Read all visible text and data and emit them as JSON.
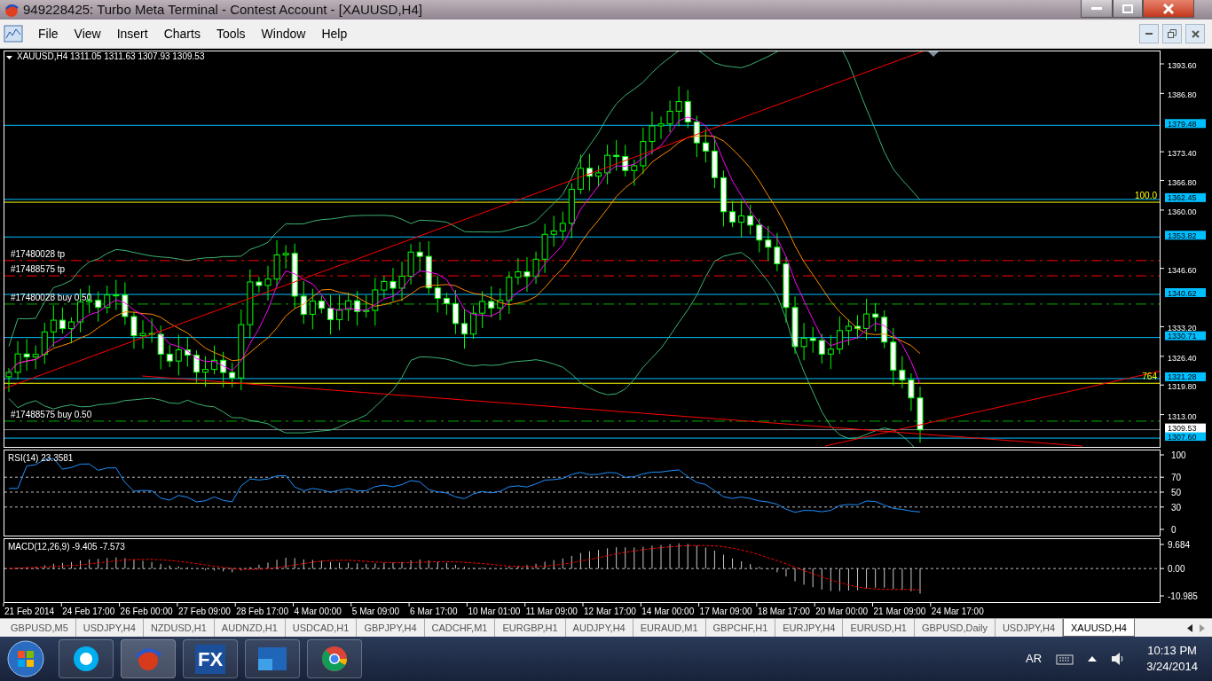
{
  "window": {
    "title": "949228425: Turbo Meta Terminal - Contest Account - [XAUUSD,H4]"
  },
  "menu": [
    "File",
    "View",
    "Insert",
    "Charts",
    "Tools",
    "Window",
    "Help"
  ],
  "chart": {
    "symbol": "XAUUSD,H4",
    "ohlc": "1311.05 1311.63 1307.93 1309.53",
    "price_ticks": [
      "1393.60",
      "1386.80",
      "1373.40",
      "1366.80",
      "1360.00",
      "1346.60",
      "1333.20",
      "1326.40",
      "1319.80",
      "1313.00"
    ],
    "levels": [
      "1379.48",
      "1362.45",
      "1353.82",
      "1340.62",
      "1330.71",
      "1321.28",
      "1307.60"
    ],
    "bid": "1309.53",
    "orders": [
      {
        "label": "#17480028 tp",
        "kind": "tp"
      },
      {
        "label": "#17488575 tp",
        "kind": "tp"
      },
      {
        "label": "#17480028 buy 0.50",
        "kind": "buy"
      },
      {
        "label": "#17488575 buy 0.50",
        "kind": "buy"
      }
    ],
    "fibo": [
      "100.0",
      "764"
    ]
  },
  "rsi": {
    "label": "RSI(14) 23.3581",
    "ticks": [
      "100",
      "70",
      "50",
      "30",
      "0"
    ]
  },
  "macd": {
    "label": "MACD(12,26,9) -9.405 -7.573",
    "ticks": [
      "9.684",
      "0.00",
      "-10.985"
    ]
  },
  "dates": [
    "21 Feb 2014",
    "24 Feb 17:00",
    "26 Feb 00:00",
    "27 Feb 09:00",
    "28 Feb 17:00",
    "4 Mar 00:00",
    "5 Mar 09:00",
    "6 Mar 17:00",
    "10 Mar 01:00",
    "11 Mar 09:00",
    "12 Mar 17:00",
    "14 Mar 00:00",
    "17 Mar 09:00",
    "18 Mar 17:00",
    "20 Mar 00:00",
    "21 Mar 09:00",
    "24 Mar 17:00"
  ],
  "tabs": [
    {
      "label": "GBPUSD,M5",
      "selected": false
    },
    {
      "label": "USDJPY,H4",
      "selected": false
    },
    {
      "label": "NZDUSD,H1",
      "selected": false
    },
    {
      "label": "AUDNZD,H1",
      "selected": false
    },
    {
      "label": "USDCAD,H1",
      "selected": false
    },
    {
      "label": "GBPJPY,H4",
      "selected": false
    },
    {
      "label": "CADCHF,M1",
      "selected": false
    },
    {
      "label": "EURGBP,H1",
      "selected": false
    },
    {
      "label": "AUDJPY,H4",
      "selected": false
    },
    {
      "label": "EURAUD,M1",
      "selected": false
    },
    {
      "label": "GBPCHF,H1",
      "selected": false
    },
    {
      "label": "EURJPY,H4",
      "selected": false
    },
    {
      "label": "EURUSD,H1",
      "selected": false
    },
    {
      "label": "GBPUSD,Daily",
      "selected": false
    },
    {
      "label": "USDJPY,H4",
      "selected": false
    },
    {
      "label": "XAUUSD,H4",
      "selected": true
    }
  ],
  "taskbar": {
    "fx_label": "FX",
    "language": "AR",
    "time": "10:13 PM",
    "date": "3/24/2014"
  }
}
